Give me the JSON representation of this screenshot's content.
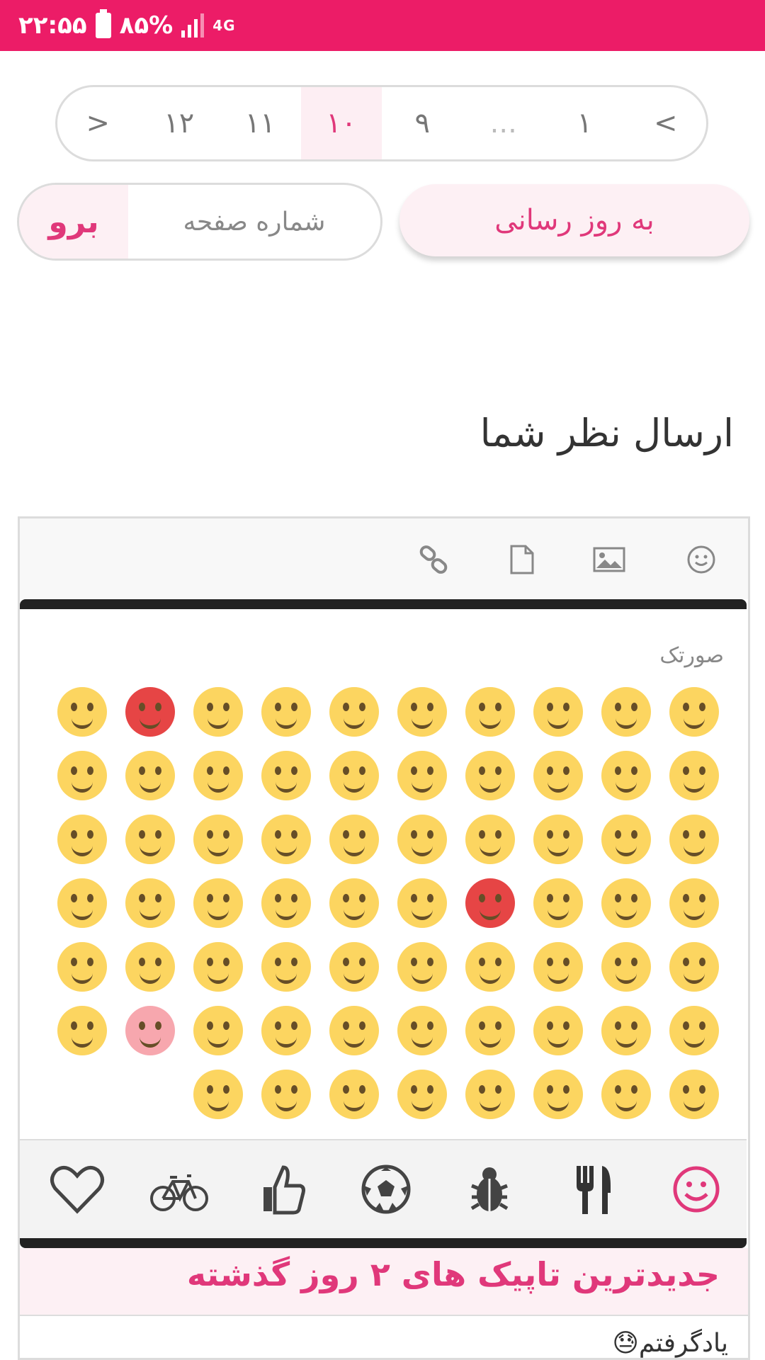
{
  "status_bar": {
    "time": "۲۲:۵۵",
    "battery": "۸۵%",
    "network": "4G",
    "background_color": "#ec1c67"
  },
  "pagination": {
    "items": [
      "<",
      "۱",
      "...",
      "۹",
      "۱۰",
      "۱۱",
      "۱۲",
      ">"
    ],
    "active": "۱۰"
  },
  "actions": {
    "update_label": "به روز رسانی",
    "page_number_placeholder": "شماره صفحه",
    "go_label": "برو"
  },
  "comment_section": {
    "title": "ارسال نظر شما",
    "toolbar_icons": [
      "smiley-icon",
      "image-icon",
      "file-icon",
      "link-icon"
    ]
  },
  "emoji_panel": {
    "category_title": "صورتک",
    "emoji_count": 68,
    "categories": [
      "smiley-icon",
      "fork-knife-icon",
      "bug-icon",
      "soccer-ball-icon",
      "thumbs-up-icon",
      "bicycle-icon",
      "heart-icon"
    ],
    "active_category": "smiley-icon",
    "accent_color": "#e0387a"
  },
  "topics": {
    "title": "جدیدترین تاپیک های ۲ روز گذشته",
    "first_item": "یادگرفتم😓"
  }
}
